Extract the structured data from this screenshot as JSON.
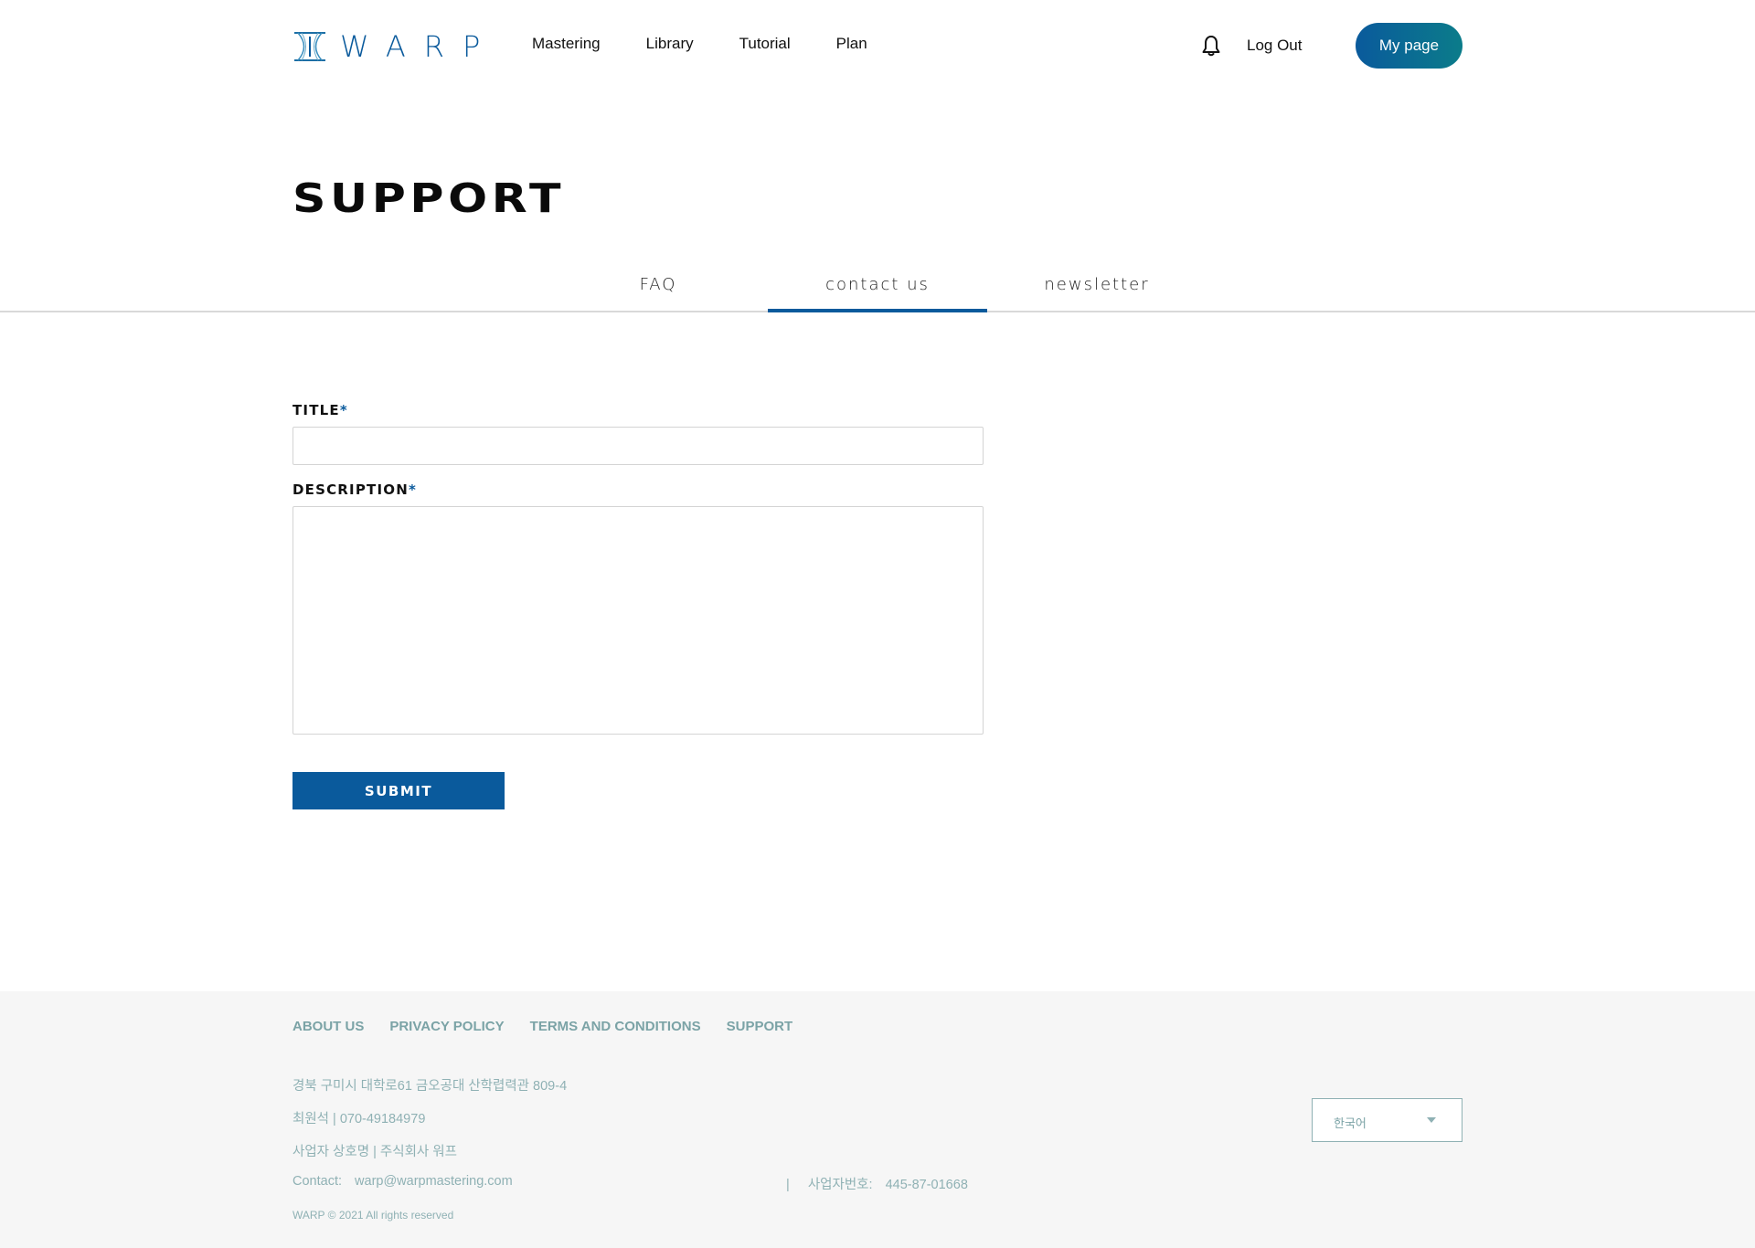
{
  "header": {
    "logo_text": "WARP",
    "nav": [
      "Mastering",
      "Library",
      "Tutorial",
      "Plan"
    ],
    "logout": "Log Out",
    "mypage": "My page"
  },
  "page": {
    "title": "SUPPORT",
    "tabs": [
      "FAQ",
      "contact us",
      "newsletter"
    ],
    "active_tab": "contact us"
  },
  "form": {
    "title_label": "TITLE",
    "description_label": "DESCRIPTION",
    "required_mark": "*",
    "title_value": "",
    "description_value": "",
    "submit": "SUBMIT"
  },
  "footer": {
    "links": [
      "ABOUT US",
      "PRIVACY POLICY",
      "TERMS AND CONDITIONS",
      "SUPPORT"
    ],
    "address": "경북 구미시 대학로61 금오공대 산학렵력관 809-4",
    "phone": "최원석 | 070-49184979",
    "company": "사업자 상호명 | 주식회사 워프",
    "contact_label": "Contact:",
    "contact_email": "warp@warpmastering.com",
    "biz_sep": "|",
    "biz_label": "사업자번호:",
    "biz_number": "445-87-01668",
    "copyright": "WARP © 2021 All rights reserved",
    "language": "한국어"
  },
  "colors": {
    "brand_blue": "#0a5a9c",
    "brand_teal": "#0b7c8a",
    "footer_text": "#8fb1b4",
    "footer_bg": "#f6f6f6"
  }
}
